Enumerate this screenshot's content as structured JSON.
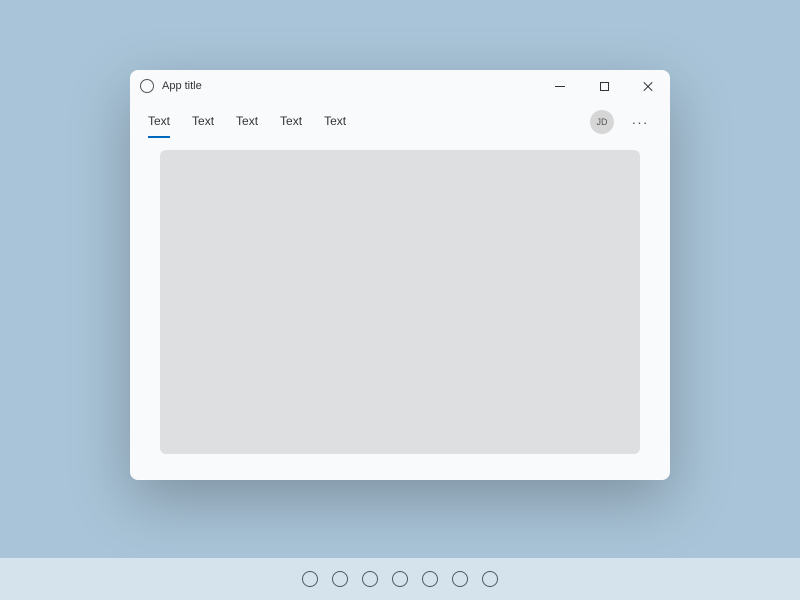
{
  "window": {
    "title": "App title"
  },
  "tabs": [
    {
      "label": "Text",
      "active": true
    },
    {
      "label": "Text",
      "active": false
    },
    {
      "label": "Text",
      "active": false
    },
    {
      "label": "Text",
      "active": false
    },
    {
      "label": "Text",
      "active": false
    }
  ],
  "user": {
    "initials": "JD"
  },
  "taskbar": {
    "icon_count": 7
  }
}
